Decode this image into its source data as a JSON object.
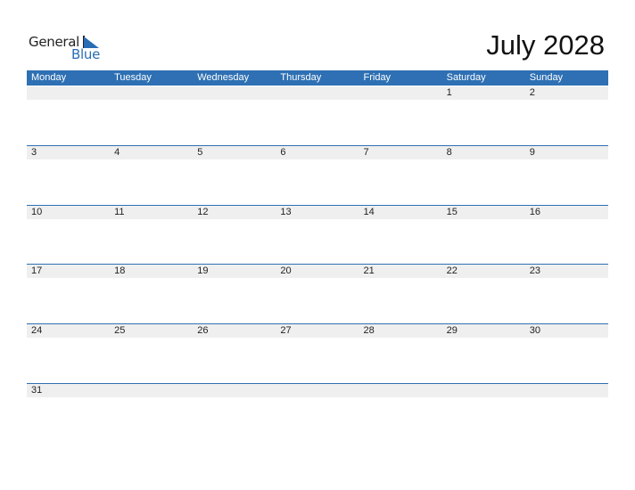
{
  "logo": {
    "general": "General",
    "blue": "Blue"
  },
  "title": "July 2028",
  "colors": {
    "accent": "#2e70b3",
    "band": "#efefef"
  },
  "weekdays": [
    "Monday",
    "Tuesday",
    "Wednesday",
    "Thursday",
    "Friday",
    "Saturday",
    "Sunday"
  ],
  "weeks": [
    [
      "",
      "",
      "",
      "",
      "",
      "1",
      "2"
    ],
    [
      "3",
      "4",
      "5",
      "6",
      "7",
      "8",
      "9"
    ],
    [
      "10",
      "11",
      "12",
      "13",
      "14",
      "15",
      "16"
    ],
    [
      "17",
      "18",
      "19",
      "20",
      "21",
      "22",
      "23"
    ],
    [
      "24",
      "25",
      "26",
      "27",
      "28",
      "29",
      "30"
    ],
    [
      "31",
      "",
      "",
      "",
      "",
      "",
      ""
    ]
  ]
}
